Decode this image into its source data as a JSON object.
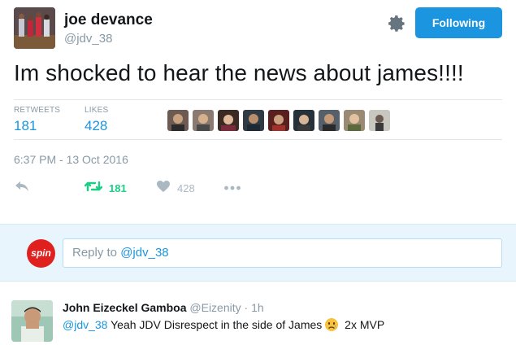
{
  "tweet": {
    "display_name": "joe devance",
    "screen_name": "@jdv_38",
    "follow_label": "Following",
    "text": "Im shocked to hear the news about james!!!!",
    "retweets_label": "RETWEETS",
    "retweets_count": "181",
    "likes_label": "LIKES",
    "likes_count": "428",
    "timestamp": "6:37 PM - 13 Oct 2016",
    "action_retweet_count": "181",
    "action_like_count": "428"
  },
  "colors": {
    "accent": "#1b95e0",
    "retweet_green": "#19cf86",
    "muted": "#8899a6",
    "reply_bg": "#e8f5fd"
  },
  "reply_box": {
    "logo_text": "spin",
    "placeholder_prefix": "Reply to ",
    "placeholder_mention": "@jdv_38"
  },
  "reply": {
    "name": "John Eizeckel Gamboa",
    "handle": "@Eizenity",
    "separator": "·",
    "time": "1h",
    "mention": "@jdv_38",
    "text_before_emoji": " Yeah JDV Disrespect in the side of James",
    "text_after_emoji": " 2x MVP"
  },
  "icons": [
    "gear-icon",
    "reply-icon",
    "retweet-icon",
    "heart-icon",
    "more-icon",
    "sad-face-emoji"
  ]
}
